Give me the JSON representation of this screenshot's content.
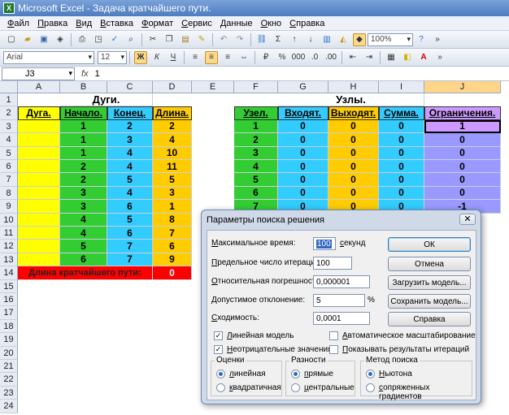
{
  "window": {
    "title": "Microsoft Excel - Задача кратчайшего пути."
  },
  "menu": [
    "Файл",
    "Правка",
    "Вид",
    "Вставка",
    "Формат",
    "Сервис",
    "Данные",
    "Окно",
    "Справка"
  ],
  "toolbar": {
    "zoom": "100%"
  },
  "format_toolbar": {
    "font": "Arial",
    "size": "12",
    "bold": "Ж",
    "italic": "К",
    "underline": "Ч"
  },
  "formula_bar": {
    "cell_ref": "J3",
    "fx": "fx",
    "value": "1"
  },
  "columns": [
    "A",
    "B",
    "C",
    "D",
    "E",
    "F",
    "G",
    "H",
    "I",
    "J"
  ],
  "rows": [
    "1",
    "2",
    "3",
    "4",
    "5",
    "6",
    "7",
    "8",
    "9",
    "10",
    "11",
    "12",
    "13",
    "14",
    "15",
    "16",
    "17",
    "18",
    "19",
    "20",
    "21",
    "22",
    "23",
    "24"
  ],
  "sheet": {
    "arcs_title": "Дуги.",
    "nodes_title": "Узлы.",
    "arc_headers": [
      "Дуга.",
      "Начало.",
      "Конец.",
      "Длина."
    ],
    "node_headers": [
      "Узел.",
      "Входят.",
      "Выходят.",
      "Сумма.",
      "Ограничения."
    ],
    "arcs": [
      [
        "1",
        "2",
        "2"
      ],
      [
        "1",
        "3",
        "4"
      ],
      [
        "1",
        "4",
        "10"
      ],
      [
        "2",
        "4",
        "11"
      ],
      [
        "2",
        "5",
        "5"
      ],
      [
        "3",
        "4",
        "3"
      ],
      [
        "3",
        "6",
        "1"
      ],
      [
        "4",
        "5",
        "8"
      ],
      [
        "4",
        "6",
        "7"
      ],
      [
        "5",
        "7",
        "6"
      ],
      [
        "6",
        "7",
        "9"
      ]
    ],
    "nodes": [
      [
        "1",
        "0",
        "0",
        "0",
        "1"
      ],
      [
        "2",
        "0",
        "0",
        "0",
        "0"
      ],
      [
        "3",
        "0",
        "0",
        "0",
        "0"
      ],
      [
        "4",
        "0",
        "0",
        "0",
        "0"
      ],
      [
        "5",
        "0",
        "0",
        "0",
        "0"
      ],
      [
        "6",
        "0",
        "0",
        "0",
        "0"
      ],
      [
        "7",
        "0",
        "0",
        "0",
        "-1"
      ]
    ],
    "shortest_label": "Длина кратчайшего пути:",
    "shortest_value": "0"
  },
  "dialog": {
    "title": "Параметры поиска решения",
    "close": "✕",
    "max_time_label": "Максимальное время:",
    "max_time_value": "100",
    "max_time_unit": "секунд",
    "iterations_label": "Предельное число итераций:",
    "iterations_value": "100",
    "precision_label": "Относительная погрешность:",
    "precision_value": "0,000001",
    "tolerance_label": "Допустимое отклонение:",
    "tolerance_value": "5",
    "tolerance_unit": "%",
    "convergence_label": "Сходимость:",
    "convergence_value": "0,0001",
    "ok": "ОК",
    "cancel": "Отмена",
    "load": "Загрузить модель...",
    "save": "Сохранить модель...",
    "help": "Справка",
    "linear_model": "Линейная модель",
    "auto_scale": "Автоматическое масштабирование",
    "non_negative": "Неотрицательные значения",
    "show_results": "Показывать результаты итераций",
    "estimates_title": "Оценки",
    "est_linear": "линейная",
    "est_quadratic": "квадратичная",
    "diff_title": "Разности",
    "diff_forward": "прямые",
    "diff_central": "центральные",
    "method_title": "Метод поиска",
    "method_newton": "Ньютона",
    "method_conjugate": "сопряженных градиентов"
  }
}
